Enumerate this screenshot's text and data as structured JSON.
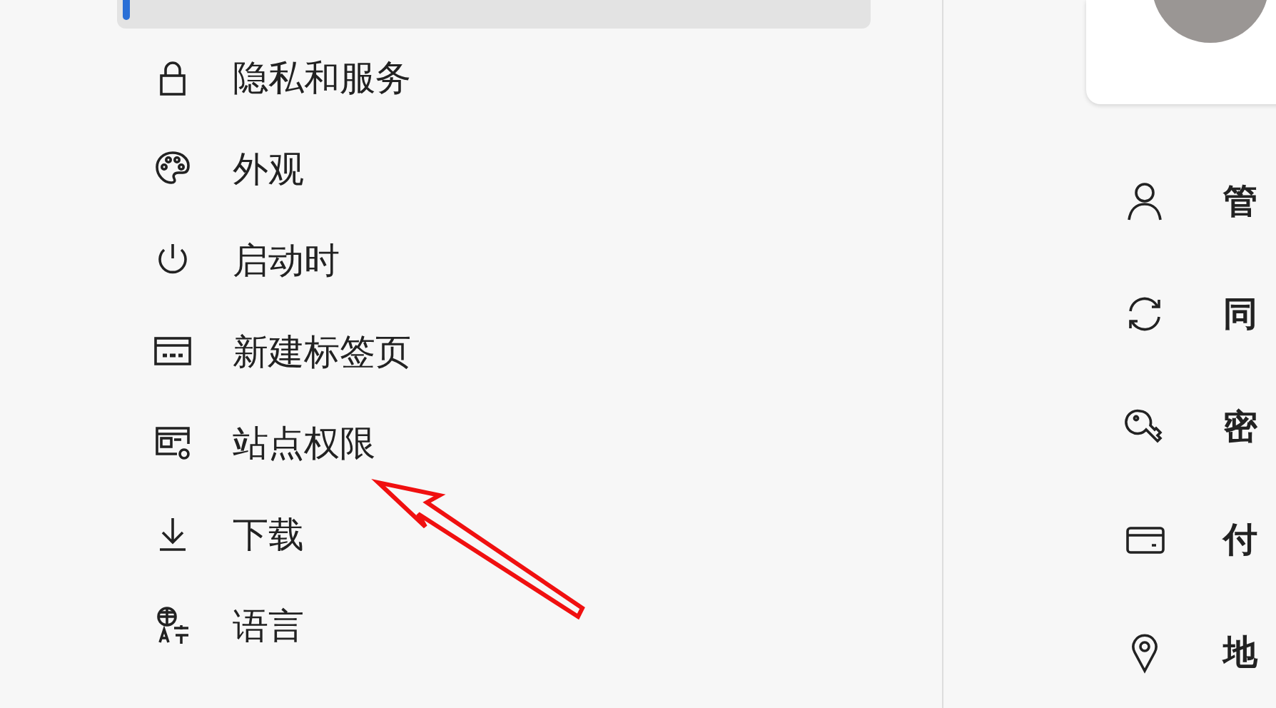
{
  "settings_nav": {
    "items": [
      {
        "selected": true
      },
      {
        "kind": "lock",
        "label": "隐私和服务",
        "selected": false
      },
      {
        "kind": "palette",
        "label": "外观",
        "selected": false
      },
      {
        "kind": "power",
        "label": "启动时",
        "selected": false
      },
      {
        "kind": "newtab",
        "label": "新建标签页",
        "selected": false
      },
      {
        "kind": "siteperm",
        "label": "站点权限",
        "selected": false
      },
      {
        "kind": "download",
        "label": "下载",
        "selected": false
      },
      {
        "kind": "language",
        "label": "语言",
        "selected": false
      }
    ]
  },
  "profile_panel": {
    "items": [
      {
        "kind": "person",
        "label": "管"
      },
      {
        "kind": "sync",
        "label": "同"
      },
      {
        "kind": "key",
        "label": "密"
      },
      {
        "kind": "card",
        "label": "付"
      },
      {
        "kind": "pin",
        "label": "地"
      }
    ]
  }
}
